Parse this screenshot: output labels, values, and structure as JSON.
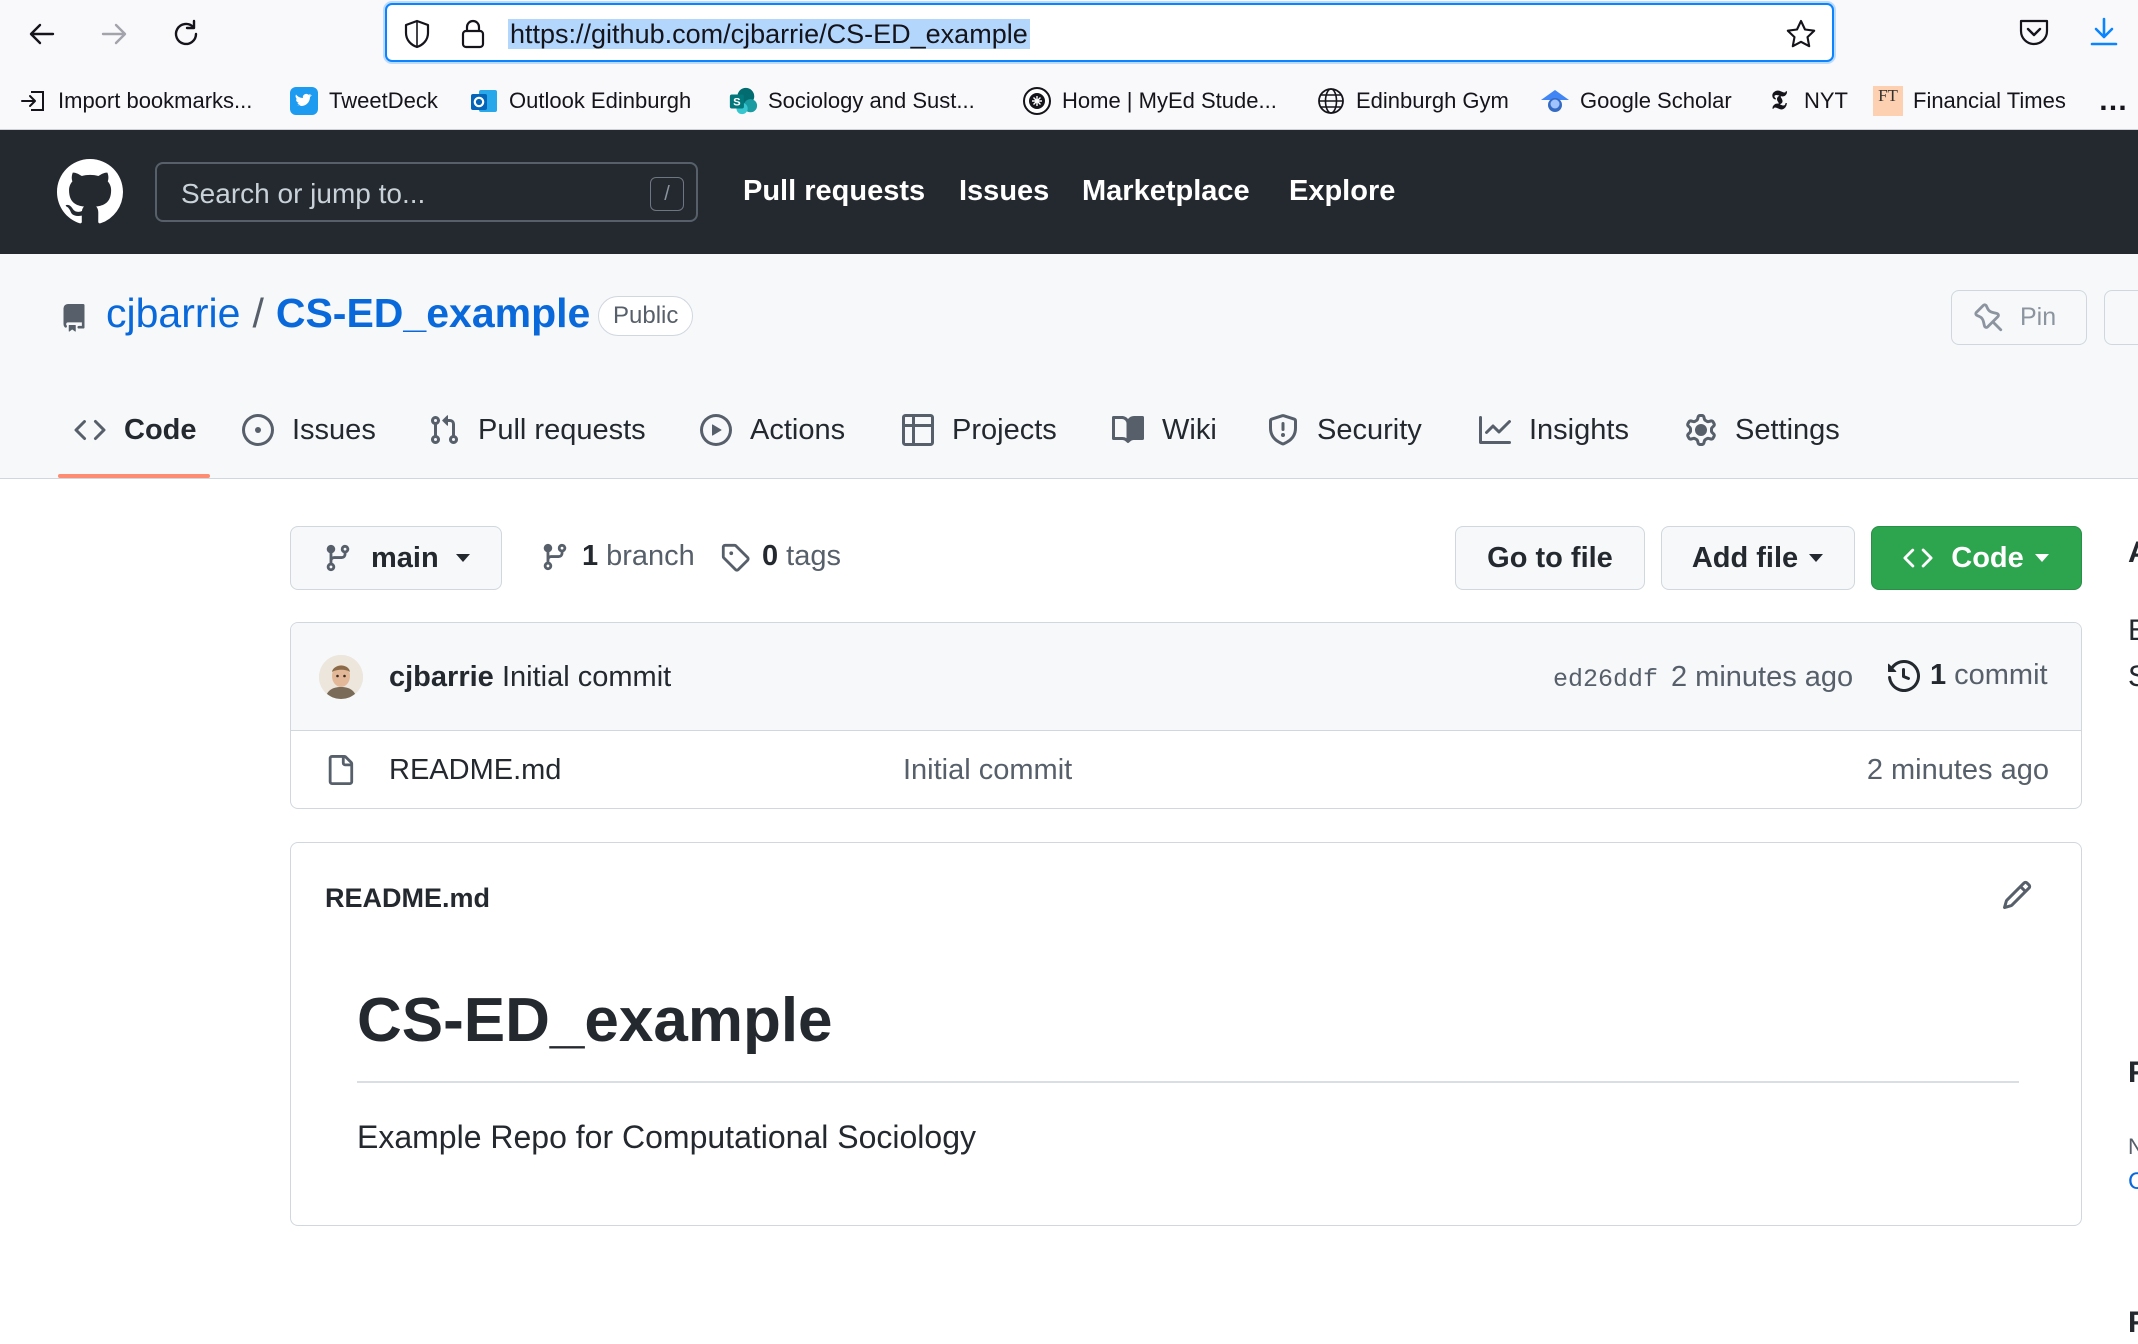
{
  "browser": {
    "url": "https://github.com/cjbarrie/CS-ED_example",
    "bookmarks": [
      {
        "label": "Import bookmarks...",
        "icon": "import-icon"
      },
      {
        "label": "TweetDeck",
        "icon": "tweetdeck-icon"
      },
      {
        "label": "Outlook Edinburgh",
        "icon": "outlook-icon"
      },
      {
        "label": "Sociology and Sust...",
        "icon": "sharepoint-icon"
      },
      {
        "label": "Home | MyEd Stude...",
        "icon": "myed-icon"
      },
      {
        "label": "Edinburgh Gym",
        "icon": "globe-icon"
      },
      {
        "label": "Google Scholar",
        "icon": "scholar-icon"
      },
      {
        "label": "NYT",
        "icon": "nyt-icon"
      },
      {
        "label": "Financial Times",
        "icon": "ft-icon"
      }
    ],
    "bookmark_badges": {
      "nyt": "𝕿",
      "ft": "FT"
    },
    "overflow": "…"
  },
  "github": {
    "search_placeholder": "Search or jump to...",
    "search_shortcut": "/",
    "nav": [
      "Pull requests",
      "Issues",
      "Marketplace",
      "Explore"
    ]
  },
  "repo": {
    "owner": "cjbarrie",
    "separator": "/",
    "name": "CS-ED_example",
    "visibility": "Public",
    "pin_label": "Pin",
    "tabs": [
      {
        "label": "Code",
        "icon": "code-icon",
        "active": true
      },
      {
        "label": "Issues",
        "icon": "issue-icon"
      },
      {
        "label": "Pull requests",
        "icon": "pull-request-icon"
      },
      {
        "label": "Actions",
        "icon": "play-icon"
      },
      {
        "label": "Projects",
        "icon": "table-icon"
      },
      {
        "label": "Wiki",
        "icon": "book-icon"
      },
      {
        "label": "Security",
        "icon": "shield-icon"
      },
      {
        "label": "Insights",
        "icon": "graph-icon"
      },
      {
        "label": "Settings",
        "icon": "gear-icon"
      }
    ]
  },
  "toolbar": {
    "branch": "main",
    "branch_count": "1",
    "branch_label": "branch",
    "tag_count": "0",
    "tag_label": "tags",
    "goto_file": "Go to file",
    "add_file": "Add file",
    "code": "Code"
  },
  "latest_commit": {
    "author": "cjbarrie",
    "message": "Initial commit",
    "sha": "ed26ddf",
    "time": "2 minutes ago",
    "count": "1",
    "count_label": "commit"
  },
  "files": [
    {
      "name": "README.md",
      "message": "Initial commit",
      "time": "2 minutes ago"
    }
  ],
  "readme": {
    "label": "README.md",
    "heading": "CS-ED_example",
    "body": "Example Repo for Computational Sociology"
  },
  "sidebar_edge": [
    "A",
    "E",
    "S",
    "F",
    "N",
    "C",
    "F"
  ],
  "colors": {
    "accent_link": "#0969da",
    "header_bg": "#24292f",
    "code_button": "#2da44e",
    "tab_underline": "#fd8c73"
  }
}
